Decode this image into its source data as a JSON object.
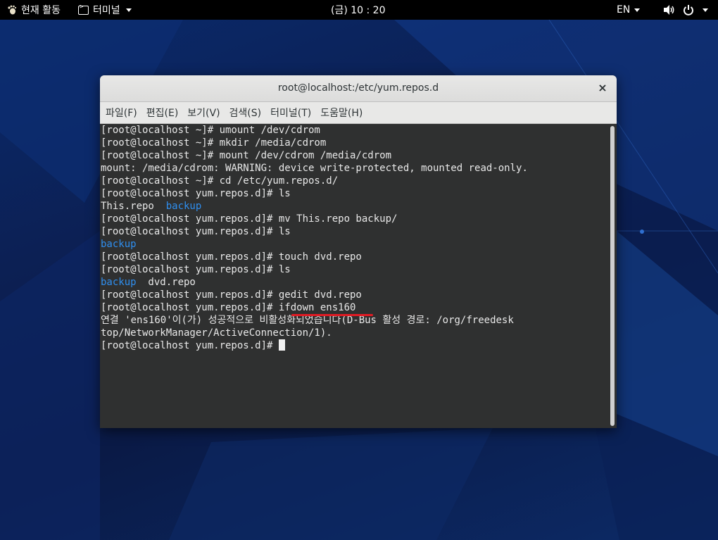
{
  "topbar": {
    "activities_label": "현재 활동",
    "app_menu_label": "터미널",
    "clock": "(금) 10 : 20",
    "input_lang": "EN"
  },
  "window": {
    "title": "root@localhost:/etc/yum.repos.d",
    "close_symbol": "×",
    "menu": [
      "파일(F)",
      "편집(E)",
      "보기(V)",
      "검색(S)",
      "터미널(T)",
      "도움말(H)"
    ]
  },
  "terminal": {
    "lines": [
      "[root@localhost ~]# umount /dev/cdrom",
      "[root@localhost ~]# mkdir /media/cdrom",
      "[root@localhost ~]# mount /dev/cdrom /media/cdrom",
      "mount: /media/cdrom: WARNING: device write-protected, mounted read-only.",
      "[root@localhost ~]# cd /etc/yum.repos.d/",
      "[root@localhost yum.repos.d]# ls",
      "This.repo  ",
      "[root@localhost yum.repos.d]# mv This.repo backup/",
      "[root@localhost yum.repos.d]# ls",
      "",
      "[root@localhost yum.repos.d]# touch dvd.repo",
      "[root@localhost yum.repos.d]# ls",
      "",
      "[root@localhost yum.repos.d]# gedit dvd.repo",
      "[root@localhost yum.repos.d]# ifdown ens160",
      "연결 'ens160'이(가) 성공적으로 비활성화되었습니다(D-Bus 활성 경로: /org/freedesk",
      "top/NetworkManager/ActiveConnection/1).",
      "[root@localhost yum.repos.d]# "
    ],
    "ls_dir_1": "backup",
    "ls_dir_2": "backup",
    "ls_dir_3": "backup",
    "ls_file_3": "  dvd.repo"
  },
  "colors": {
    "terminal_bg": "#2f3030",
    "directory": "#2f8ff0",
    "annotation": "#e01b24"
  }
}
